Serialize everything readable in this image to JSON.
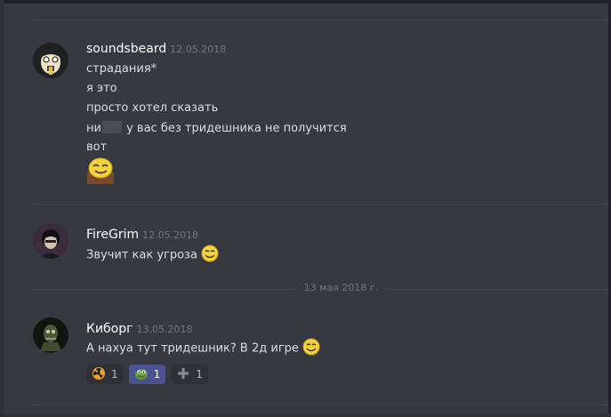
{
  "messages": [
    {
      "username": "soundsbeard",
      "timestamp": "12.05.2018",
      "lines": [
        "страдания*",
        "я это",
        "просто хотел сказать",
        "ни",
        "у вас без тридешника не получится",
        "вот"
      ]
    },
    {
      "username": "FireGrim",
      "timestamp": "12.05.2018",
      "text": "Звучит как угроза"
    },
    {
      "username": "Киборг",
      "timestamp": "13.05.2018",
      "text": "А нахуа тут тридешник? В 2д игре"
    }
  ],
  "date_separator": "13 мая 2018 г.",
  "reactions": [
    {
      "icon": "radiation-emoji-icon",
      "count": "1",
      "active": false
    },
    {
      "icon": "pepe-frog-emoji-icon",
      "count": "1",
      "active": true
    },
    {
      "icon": "plus-emoji-icon",
      "count": "1",
      "active": false
    }
  ],
  "colors": {
    "background": "#36393f",
    "username": "#ffffff",
    "timestamp": "#72767d",
    "active_reaction": "#4a5294"
  }
}
